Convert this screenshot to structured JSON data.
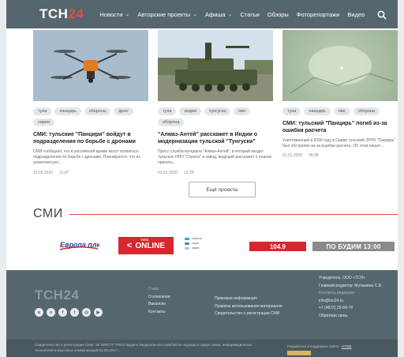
{
  "header": {
    "logo_main": "ТСН",
    "logo_accent": "24",
    "nav": [
      {
        "label": "Новости",
        "dropdown": true
      },
      {
        "label": "Авторские проекты",
        "dropdown": true
      },
      {
        "label": "Афиша",
        "dropdown": true
      },
      {
        "label": "Статьи",
        "dropdown": false
      },
      {
        "label": "Обзоры",
        "dropdown": false
      },
      {
        "label": "Фоторепортажи",
        "dropdown": false
      },
      {
        "label": "Видео",
        "dropdown": false
      }
    ],
    "search_icon": "search-icon"
  },
  "cards": [
    {
      "image": "drone photo",
      "tags": [
        "тула",
        "панцирь",
        "оборона",
        "дрон",
        "сирия"
      ],
      "title": "СМИ: тульские \"Панцири\" войдут в подразделения по борьбе с дронами",
      "text": "СМИ сообщают, что в российской армии могут появиться подразделения по борьбе с дронами. Планируется, что их укомплектуют...",
      "date": "10.02.2020",
      "time": "11:07"
    },
    {
      "image": "armored vehicle photo",
      "tags": [
        "тула",
        "индия",
        "тунгуска",
        "пво",
        "оборона"
      ],
      "title": "\"Алмаз-Антей\" расскажет в Индии о модернизации тульской \"Тунгуски\"",
      "text": "Пресс-служба концерна \"Алмаз-Антей\", в который входит тульское НПО \"Стрела\" и завод, ведущий расскажет о планах принять...",
      "date": "01.01.2020",
      "time": "12:29"
    },
    {
      "image": "night sky photo",
      "tags": [
        "тула",
        "панцирь",
        "пво",
        "оборона"
      ],
      "title": "СМИ: тульский \"Панцирь\" погиб из-за ошибки расчета",
      "text": "Уничтоженный в 2018 году в Сирии тульский ЗРПК \"Панцирь\" был обстрелян из-за ошибки расчета. Об этом пишет...",
      "date": "01.01.2020",
      "time": "09:28"
    }
  ],
  "more_button": "Ещё проекты",
  "smi": {
    "title": "СМИ",
    "partners": {
      "evropa": "Европа плюс",
      "tula_top": "ТУЛА",
      "tula_main": "ONLINE",
      "tula_arrow": "<",
      "radio_lines": [
        "новости",
        "спорт",
        "видео"
      ],
      "radio_1049": "104.9",
      "budim": "ПО БУДИМ 13:00"
    },
    "accent_color": "#e84c3d"
  },
  "footer": {
    "logo": "ТСН24",
    "socials": [
      "vk",
      "ok",
      "fb",
      "tw",
      "ig",
      "yt"
    ],
    "social_glyphs": [
      "в",
      "о",
      "f",
      "t",
      "◎",
      "▶"
    ],
    "col1": {
      "head": "О нас",
      "links": [
        "О компании",
        "Вакансии",
        "Контакты"
      ]
    },
    "col2": {
      "links": [
        "Правовая информация",
        "Правила использования материалов",
        "Свидетельство о регистрации СМИ"
      ]
    },
    "col3": {
      "lines": [
        "Учредитель: ООО «ТСН»",
        "Главный редактор: Мульмина С.В."
      ],
      "contacts_head": "Контакты редакции:",
      "email": "info@tsn24.ru",
      "phone": "+7 (4872) 25-84-74",
      "feedback": "Обратная связь"
    },
    "legal": "Свидетельство о регистрации СМИ: Эл №ФС77-70013 выдано Федеральной службой по надзору в сфере связи, информационных технологий и массовых коммуникаций 02.06.2017 г.",
    "dev_text": "Разработка и поддержка сайта - ",
    "dev_link": "UTMB"
  },
  "colors": {
    "header_bg": "#56666e",
    "accent": "#e84c3d",
    "footer_bg": "#56666e"
  }
}
